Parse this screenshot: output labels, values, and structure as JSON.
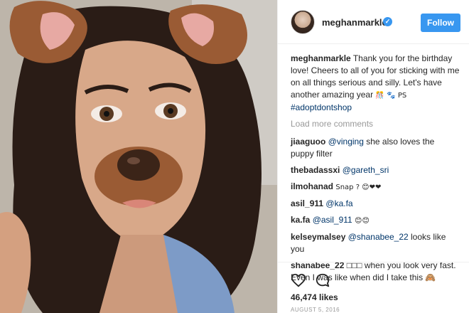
{
  "post": {
    "username": "meghanmarkle",
    "follow_label": "Follow",
    "verified_icon": "checkmark-icon"
  },
  "caption": {
    "user": "meghanmarkle",
    "text": "Thank you for the birthday love! Cheers to all of you for sticking with me on all things serious and silly. Let's have another amazing year",
    "emoji_1": "🎊",
    "ps_prefix": "🐾 PS",
    "hashtag": "#adoptdontshop"
  },
  "load_more": "Load more comments",
  "comments": [
    {
      "user": "jiaaguoo",
      "mention": "@vinging",
      "text": "she also loves the puppy filter"
    },
    {
      "user": "thebadassxi",
      "mention": "@gareth_sri",
      "text": ""
    },
    {
      "user": "ilmohanad",
      "mention": "",
      "text": "Snap ? 😊❤❤"
    },
    {
      "user": "asil_911",
      "mention": "@ka.fa",
      "text": ""
    },
    {
      "user": "ka.fa",
      "mention": "@asil_911",
      "text": "😊😊"
    },
    {
      "user": "kelseymalsey",
      "mention": "@shanabee_22",
      "text": "looks like you"
    },
    {
      "user": "shanabee_22",
      "mention": "",
      "text": "□□□ when you look very fast. Even I was like when did I take this 🙈"
    }
  ],
  "likes": "46,474 likes",
  "date": "AUGUST 5, 2016",
  "icons": {
    "like": "heart-outline-icon",
    "comment": "speech-bubble-icon"
  },
  "colors": {
    "accent": "#3897f0",
    "link": "#003569",
    "muted": "#999999"
  }
}
